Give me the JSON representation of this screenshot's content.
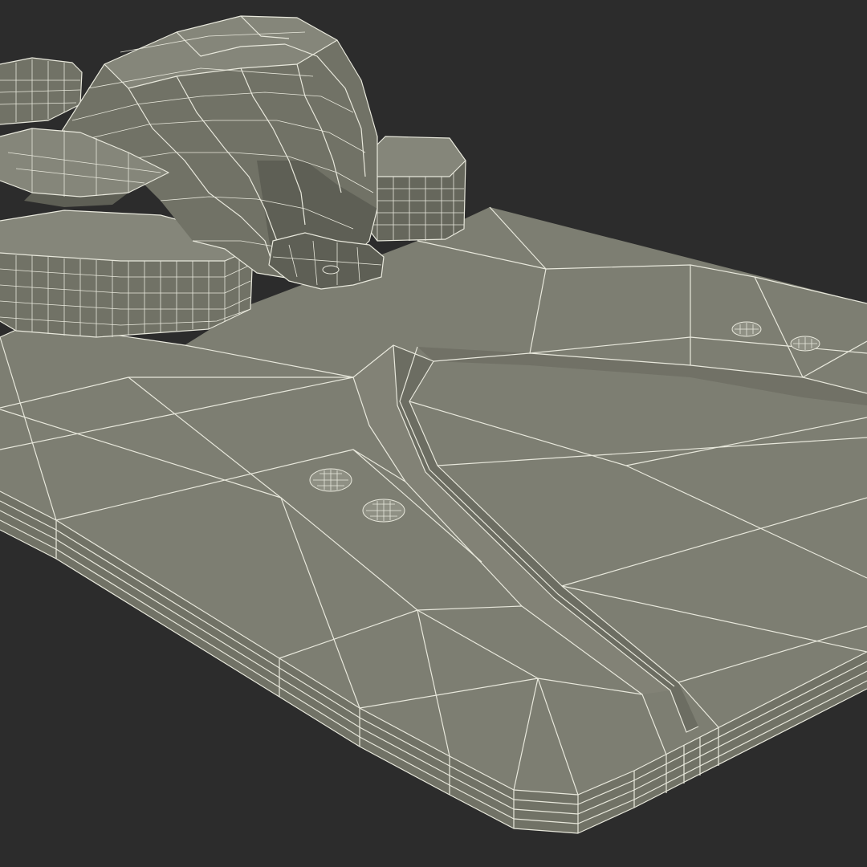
{
  "scene": {
    "background_color": "#2c2c2c",
    "surface_color": "#7d7e72",
    "wire_color": "#e8e8dc",
    "subject": "wireframe-3d-model",
    "elements": [
      {
        "name": "deck-board"
      },
      {
        "name": "binding-shell"
      },
      {
        "name": "rivet-pair-front"
      },
      {
        "name": "rivet-pair-rear"
      }
    ]
  }
}
